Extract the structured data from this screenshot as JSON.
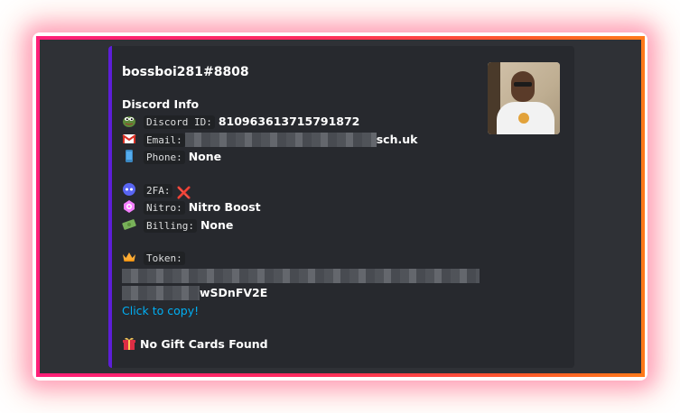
{
  "embed": {
    "author": "bossboi281#8808",
    "section_title": "Discord Info",
    "discord_id_label": "Discord ID:",
    "discord_id_value": "810963613715791872",
    "email_label": "Email:",
    "email_suffix": "sch.uk",
    "phone_label": "Phone:",
    "phone_value": "None",
    "twofa_label": "2FA:",
    "twofa_icon": "❌",
    "nitro_label": "Nitro:",
    "nitro_value": "Nitro Boost",
    "billing_label": "Billing:",
    "billing_value": "None",
    "token_label": "Token:",
    "token_suffix": "wSDnFV2E",
    "copy_link": "Click to copy!",
    "gift_text": "No Gift Cards Found"
  },
  "icons": {
    "discord_id": "pepe-icon",
    "email": "gmail-icon",
    "phone": "phone-icon",
    "twofa": "bot-icon",
    "nitro": "nitro-icon",
    "billing": "money-icon",
    "token": "crown-icon",
    "gift": "gift-icon"
  },
  "colors": {
    "accent_bar": "#5d1ed8",
    "link": "#00aff4",
    "frame_start": "#ff1f78",
    "frame_end": "#ff7a1a"
  }
}
